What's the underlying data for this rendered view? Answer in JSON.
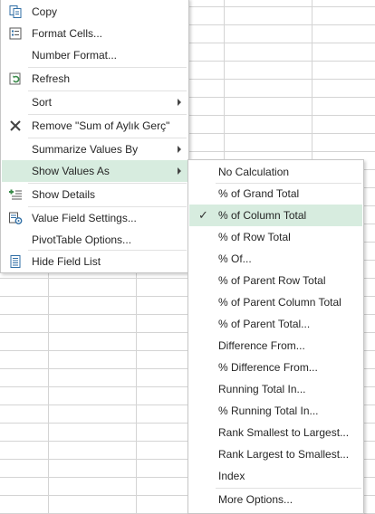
{
  "context_menu": {
    "items": [
      {
        "label": "Copy",
        "icon": "copy-icon"
      },
      {
        "label": "Format Cells...",
        "icon": "format-cells-icon"
      },
      {
        "label": "Number Format...",
        "icon": ""
      },
      {
        "label": "Refresh",
        "icon": "refresh-icon"
      },
      {
        "label": "Sort",
        "icon": "",
        "submenu": true
      },
      {
        "label": "Remove \"Sum of Aylık Gerç\"",
        "icon": "remove-x-icon"
      },
      {
        "label": "Summarize Values By",
        "icon": "",
        "submenu": true
      },
      {
        "label": "Show Values As",
        "icon": "",
        "submenu": true,
        "highlighted": true
      },
      {
        "label": "Show Details",
        "icon": "show-details-icon"
      },
      {
        "label": "Value Field Settings...",
        "icon": "field-settings-icon"
      },
      {
        "label": "PivotTable Options...",
        "icon": ""
      },
      {
        "label": "Hide Field List",
        "icon": "field-list-icon"
      }
    ]
  },
  "submenu": {
    "items": [
      {
        "label": "No Calculation"
      },
      {
        "label": "% of Grand Total"
      },
      {
        "label": "% of Column Total",
        "checked": true
      },
      {
        "label": "% of Row Total"
      },
      {
        "label": "% Of..."
      },
      {
        "label": "% of Parent Row Total"
      },
      {
        "label": "% of Parent Column Total"
      },
      {
        "label": "% of Parent Total..."
      },
      {
        "label": "Difference From..."
      },
      {
        "label": "% Difference From..."
      },
      {
        "label": "Running Total In..."
      },
      {
        "label": "% Running Total In..."
      },
      {
        "label": "Rank Smallest to Largest..."
      },
      {
        "label": "Rank Largest to Smallest..."
      },
      {
        "label": "Index"
      },
      {
        "label": "More Options..."
      }
    ],
    "check_glyph": "✓"
  },
  "colors": {
    "highlight": "#d7ecdf",
    "icon_blue": "#2f6ea5",
    "icon_green": "#3a8a4a"
  }
}
